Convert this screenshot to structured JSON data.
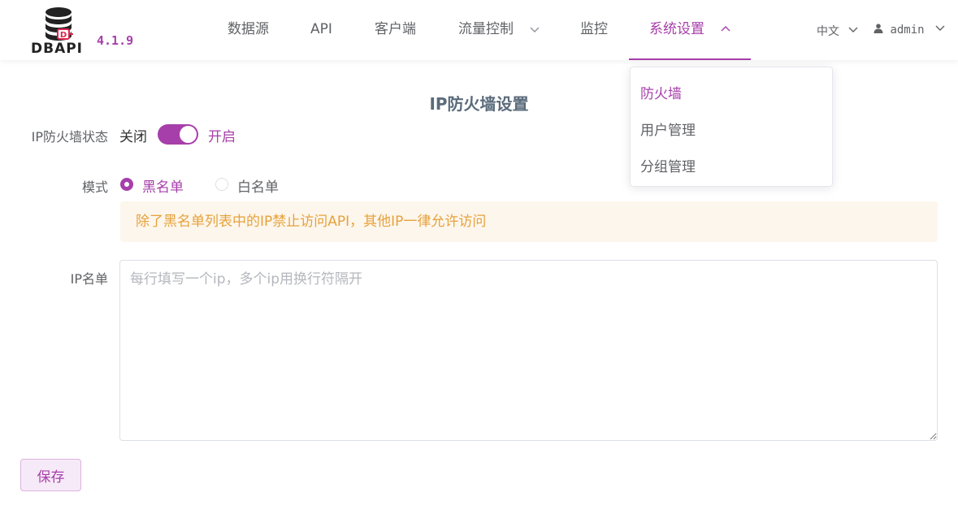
{
  "brand": {
    "logo_text": "DBAPI",
    "version": "4.1.9",
    "accent_color": "#a63faa"
  },
  "nav": {
    "items": [
      {
        "label": "数据源"
      },
      {
        "label": "API"
      },
      {
        "label": "客户端"
      },
      {
        "label": "流量控制",
        "has_dropdown": true
      },
      {
        "label": "监控"
      },
      {
        "label": "系统设置",
        "has_dropdown": true,
        "active": true
      }
    ],
    "language": "中文",
    "user": "admin"
  },
  "system_menu": {
    "items": [
      {
        "label": "防火墙",
        "active": true
      },
      {
        "label": "用户管理"
      },
      {
        "label": "分组管理"
      }
    ]
  },
  "page": {
    "title": "IP防火墙设置",
    "status": {
      "label": "IP防火墙状态",
      "off_text": "关闭",
      "on_text": "开启",
      "enabled": true
    },
    "mode": {
      "label": "模式",
      "options": [
        {
          "label": "黑名单",
          "selected": true
        },
        {
          "label": "白名单",
          "selected": false
        }
      ],
      "hint": "除了黑名单列表中的IP禁止访问API，其他IP一律允许访问"
    },
    "ip_list": {
      "label": "IP名单",
      "value": "",
      "placeholder": "每行填写一个ip，多个ip用换行符隔开"
    },
    "save_label": "保存"
  }
}
